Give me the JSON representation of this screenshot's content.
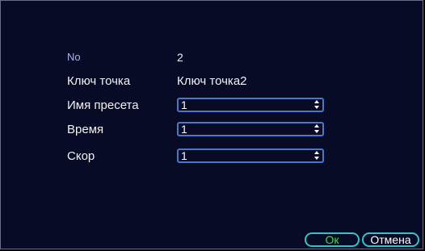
{
  "form": {
    "no_label": "No",
    "no_value": "2",
    "key_label": "Ключ точка",
    "key_value": "Ключ точка2",
    "preset_label": "Имя пресета",
    "preset_value": "1",
    "time_label": "Время",
    "time_value": "1",
    "speed_label": "Скор",
    "speed_value": "1"
  },
  "buttons": {
    "ok": "Ок",
    "cancel": "Отмена"
  },
  "colors": {
    "background": "#070b26",
    "field_border": "#4b77c9",
    "button_border": "#38c2c8",
    "ok_text": "#37e03c"
  }
}
